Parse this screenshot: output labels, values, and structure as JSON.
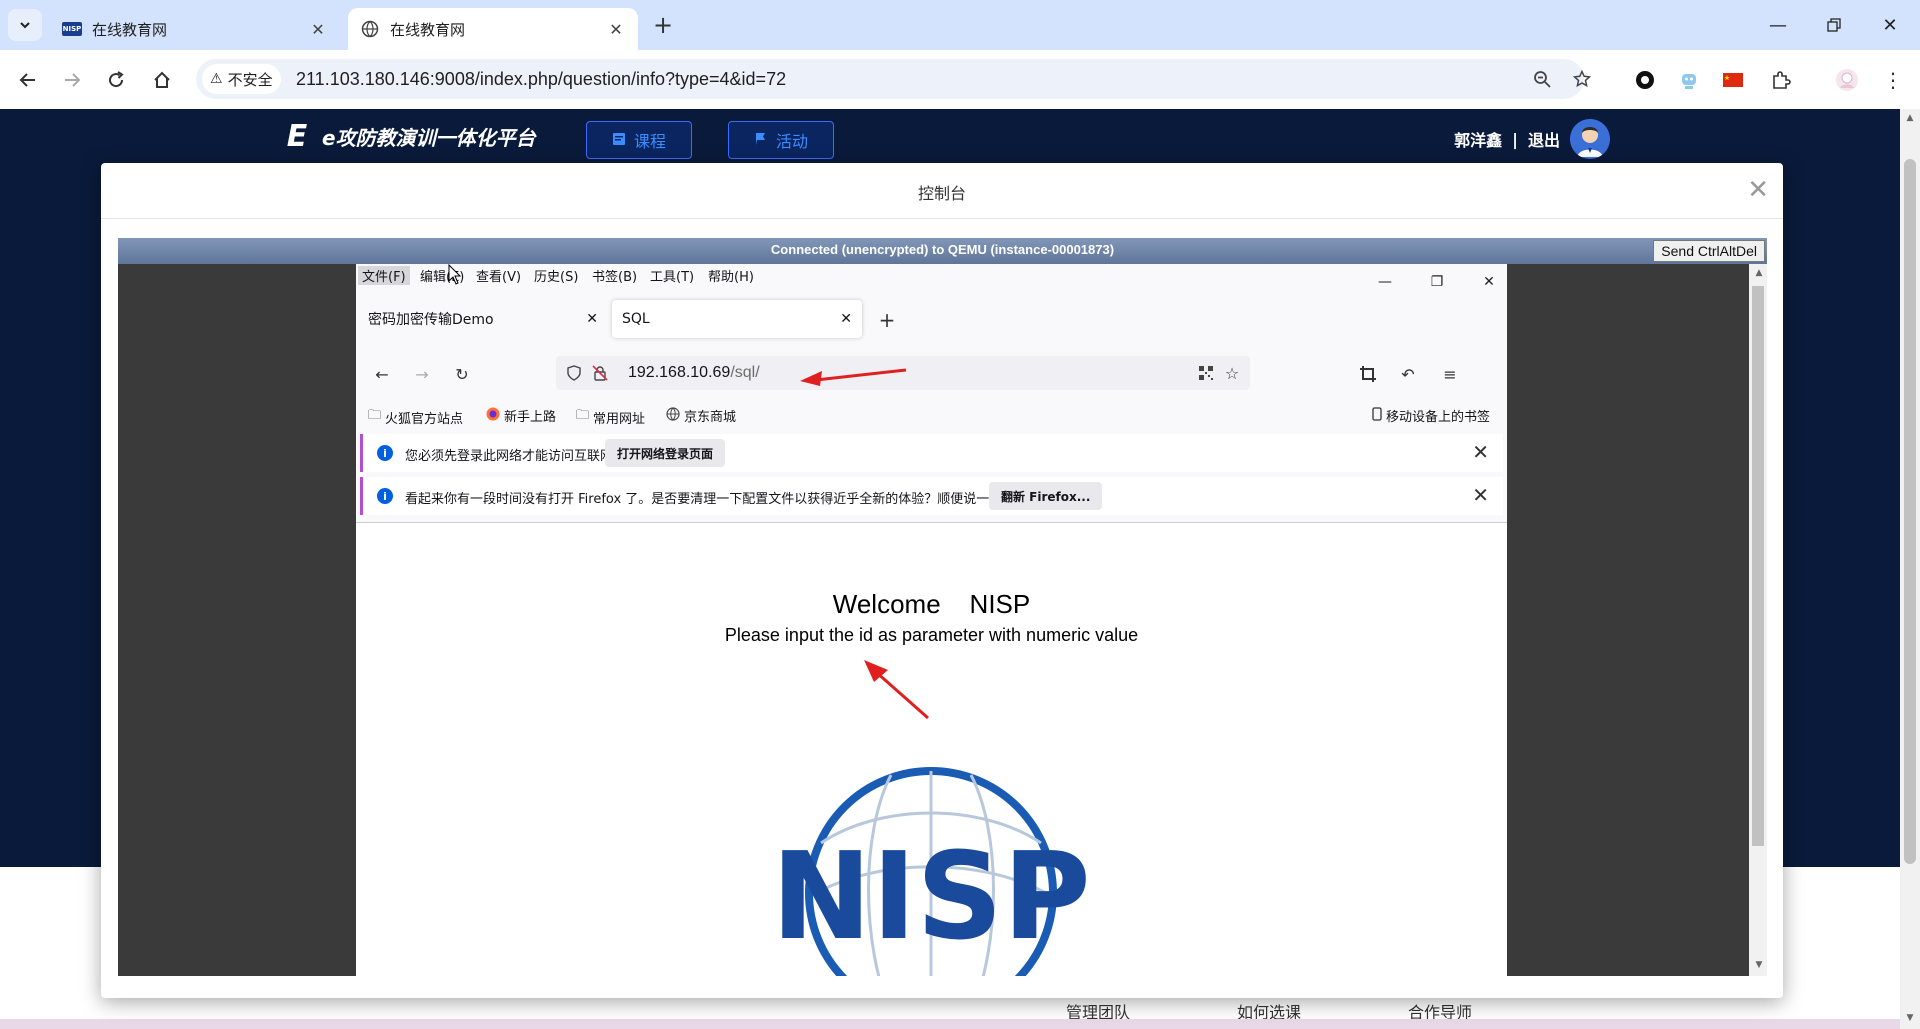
{
  "browser": {
    "tabs": [
      {
        "title": "在线教育网",
        "active": false
      },
      {
        "title": "在线教育网",
        "active": true
      }
    ],
    "address": {
      "security_label": "不安全",
      "url": "211.103.180.146:9008/index.php/question/info?type=4&id=72"
    }
  },
  "site": {
    "logo_text": "e攻防教演训一体化平台",
    "nav": [
      {
        "label": "课程",
        "icon": "book-icon"
      },
      {
        "label": "活动",
        "icon": "flag-icon"
      }
    ],
    "user_name": "郭洋鑫",
    "separator": "|",
    "logout": "退出",
    "footer_links": [
      "管理团队",
      "如何选课",
      "合作导师"
    ]
  },
  "modal": {
    "title": "控制台",
    "vnc_status": "Connected (unencrypted) to QEMU (instance-00001873)",
    "ctrl_alt_del": "Send CtrlAltDel"
  },
  "firefox": {
    "menu": [
      "文件(F)",
      "编辑(E)",
      "查看(V)",
      "历史(S)",
      "书签(B)",
      "工具(T)",
      "帮助(H)"
    ],
    "tabs": [
      {
        "title": "密码加密传输Demo",
        "active": false
      },
      {
        "title": "SQL",
        "active": true
      }
    ],
    "url_host": "192.168.10.69",
    "url_path": "/sql/",
    "bookmarks": [
      "火狐官方站点",
      "新手上路",
      "常用网址",
      "京东商城"
    ],
    "mobile_bookmarks": "移动设备上的书签",
    "notices": [
      {
        "message": "您必须先登录此网络才能访问互联网。",
        "button": "打开网络登录页面"
      },
      {
        "message": "看起来你有一段时间没有打开 Firefox 了。是否要清理一下配置文件以获得近乎全新的体验？顺便说一句，欢迎回来！",
        "button": "翻新 Firefox..."
      }
    ],
    "page": {
      "welcome": "Welcome    NISP",
      "subtitle": "Please input the id as parameter with numeric value",
      "logo_text": "NISP"
    }
  },
  "colors": {
    "chrome_tabstrip": "#d3e3fd",
    "site_banner": "#0a1a3a",
    "nav_accent": "#3c8cff",
    "annotation_red": "#e02020",
    "nisp_blue": "#1a4a9c"
  }
}
